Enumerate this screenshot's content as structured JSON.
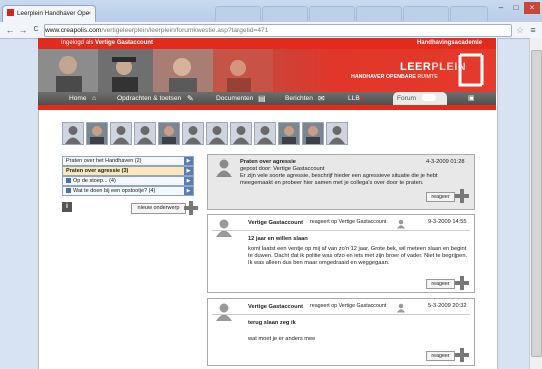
{
  "browser": {
    "tab_title": "Leerplein Handhaver Ope",
    "tab_close": "×",
    "url_scheme": "www.creapolis.com",
    "url_path": "/vertigeleerplein/leerplein/forumkwestie.asp?targetid=471",
    "back": "←",
    "forward": "→",
    "reload": "C",
    "star": "☆",
    "menu": "≡",
    "minimize": "–",
    "maximize": "□",
    "close": "×"
  },
  "header": {
    "logged_in_prefix": "Ingelogd als",
    "logged_in_user": "Vertige Gastaccount",
    "academy": "Handhavingsacademie",
    "logo_part1": "LEER",
    "logo_part2": "PLEIN",
    "subtitle1": "HANDHAVER OPENBARE",
    "subtitle2": "RUIMTE"
  },
  "menu": {
    "home": "Home",
    "opdrachten": "Opdrachten & toetsen",
    "documenten": "Documenten",
    "berichten": "Berichten",
    "llb": "LLB",
    "forum": "Forum"
  },
  "categories": [
    {
      "label": "Praten over het Handhaven (2)"
    },
    {
      "label": "Praten over agressie (3)"
    },
    {
      "label": "Op de stoep... (4)"
    },
    {
      "label": "Wat te doen bij een opstootje? (4)"
    }
  ],
  "actions": {
    "info": "i",
    "new_topic": "nieuw onderwerp"
  },
  "thread": {
    "title": "Praten over agressie",
    "posted_by": "gepost door: Vertige Gastaccount",
    "date": "4-3-2009 01:28",
    "body": "Er zijn vele soorte agressie, beschrijf hieder een agressieve situatie die je hebt meegemaakt en probeer hier samen met je collega's over door te praten.",
    "reply_label": "reageer"
  },
  "replies": [
    {
      "author": "Vertige Gastaccount",
      "reply_to": "reageert op Vertige Gastaccount",
      "date": "9-3-2009 14:55",
      "subject": "12 jaar en willen slaan",
      "body": "komt laatst een ventje op mij af van zo'n 12 jaar. Grote bek, wil meteen slaan en begint te duwen. Dacht dat ik politie was ofzo en iets met zijn broer of vader. Niet te begrijpen. Ik was alleen dus ben maar omgedraaid en weggegaan.",
      "reply_label": "reageer"
    },
    {
      "author": "Vertige Gastaccount",
      "reply_to": "reageert op Vertige Gastaccount",
      "date": "5-3-2009 20:32",
      "subject": "terug slaan zeg ik",
      "body": "wat moet je er anders mee",
      "reply_label": "reageer"
    }
  ],
  "colors": {
    "brand_red": "#e32b1c",
    "menu_gray": "#5a5a5a",
    "selected_category": "#fde7b8"
  }
}
